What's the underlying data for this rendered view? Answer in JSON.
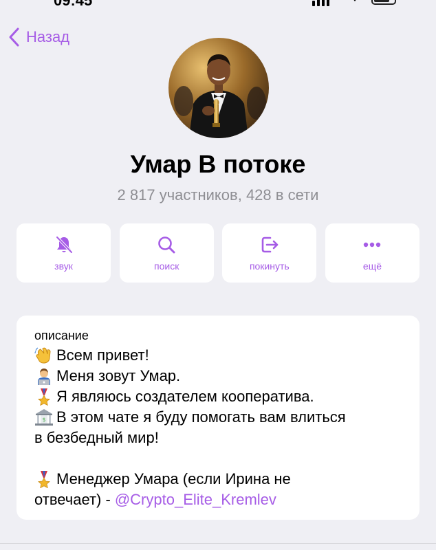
{
  "nav": {
    "back_label": "Назад"
  },
  "group": {
    "title": "Умар В потоке",
    "subtitle": "2 817 участников, 428 в сети",
    "avatar_icon": "profile-photo"
  },
  "actions": [
    {
      "label": "звук",
      "icon": "bell-muted-icon"
    },
    {
      "label": "поиск",
      "icon": "search-icon"
    },
    {
      "label": "покинуть",
      "icon": "leave-icon"
    },
    {
      "label": "ещё",
      "icon": "more-icon"
    }
  ],
  "description": {
    "heading": "описание",
    "lines": [
      {
        "emoji": "waving-hand",
        "text": "Всем привет!"
      },
      {
        "emoji": "office-worker",
        "text": "Меня зовут Умар."
      },
      {
        "emoji": "medal",
        "text": "Я являюсь создателем кооператива."
      },
      {
        "emoji": "bank",
        "text": "В этом чате я буду помогать вам влиться"
      },
      {
        "emoji": "",
        "text": "в безбедный мир!"
      },
      {
        "emoji": "",
        "text": ""
      },
      {
        "emoji": "medal",
        "text": "Менеджер Умара  (если Ирина не"
      },
      {
        "emoji": "",
        "text": "отвечает) -"
      }
    ],
    "link": "@Crypto_Elite_Kremlev"
  },
  "colors": {
    "accent": "#a65ce6",
    "background": "#efeff4",
    "card": "#ffffff",
    "secondary_text": "#8e8e93"
  }
}
